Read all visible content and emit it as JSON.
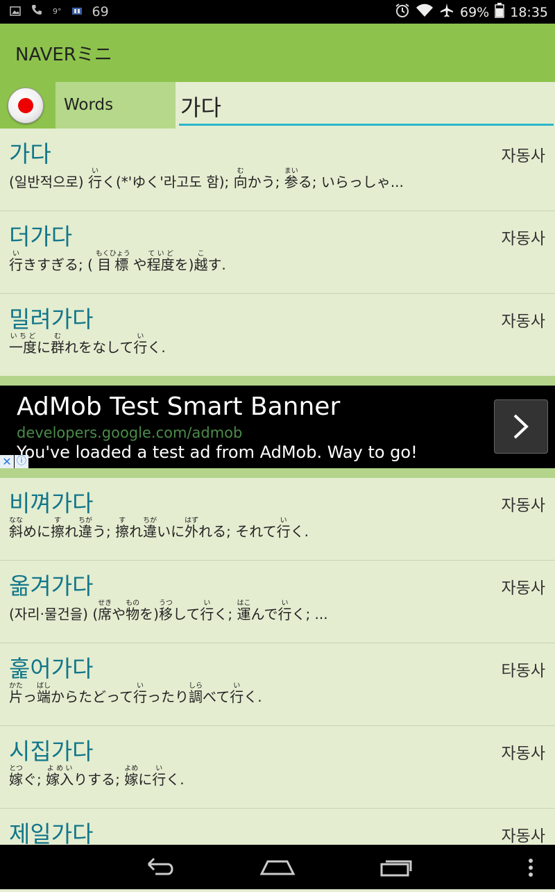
{
  "status_bar": {
    "left_icons": [
      "image-icon",
      "phone-icon",
      "notification-icon",
      "sim-icon"
    ],
    "notification_count": "69",
    "battery_percent": "69%",
    "time": "18:35",
    "right_icons": [
      "alarm-icon",
      "wifi-icon",
      "airplane-icon",
      "battery-icon"
    ]
  },
  "app_bar": {
    "title": "NAVERミニ"
  },
  "search": {
    "mode_label": "Words",
    "query": "가다"
  },
  "entries_top": [
    {
      "word": "가다",
      "pos": "자동사"
    },
    {
      "word": "더가다",
      "pos": "자동사"
    },
    {
      "word": "밀려가다",
      "pos": "자동사"
    }
  ],
  "ad": {
    "title": "AdMob Test Smart Banner",
    "url": "developers.google.com/admob",
    "text": "You've loaded a test ad from AdMob. Way to go!"
  },
  "entries_bottom": [
    {
      "word": "비껴가다",
      "pos": "자동사"
    },
    {
      "word": "옮겨가다",
      "pos": "자동사"
    },
    {
      "word": "훑어가다",
      "pos": "타동사"
    },
    {
      "word": "시집가다",
      "pos": "자동사"
    },
    {
      "word": "제일가다",
      "pos": "자동사"
    }
  ],
  "definitions": {
    "e0": [
      {
        "t": "(일반적으로) "
      },
      {
        "r": "行",
        "f": "い"
      },
      {
        "t": "く(*'ゆく'라고도 함); "
      },
      {
        "r": "向",
        "f": "む"
      },
      {
        "t": "かう; "
      },
      {
        "r": "参",
        "f": "まい"
      },
      {
        "t": "る; いらっしゃ..."
      }
    ],
    "e1": [
      {
        "r": "行",
        "f": "い"
      },
      {
        "t": "きすぎる; ( "
      },
      {
        "r": "目標",
        "f": "もくひょう"
      },
      {
        "t": " や"
      },
      {
        "r": "程度",
        "f": "ていど"
      },
      {
        "t": "を)"
      },
      {
        "r": "越",
        "f": "こ"
      },
      {
        "t": "す."
      }
    ],
    "e2": [
      {
        "r": "一度",
        "f": "いちど"
      },
      {
        "t": "に"
      },
      {
        "r": "群",
        "f": "む"
      },
      {
        "t": "れをなして"
      },
      {
        "r": "行",
        "f": "い"
      },
      {
        "t": "く."
      }
    ],
    "e3": [
      {
        "r": "斜",
        "f": "なな"
      },
      {
        "t": "めに"
      },
      {
        "r": "擦",
        "f": "す"
      },
      {
        "t": "れ"
      },
      {
        "r": "違",
        "f": "ちが"
      },
      {
        "t": "う; "
      },
      {
        "r": "擦",
        "f": "す"
      },
      {
        "t": "れ"
      },
      {
        "r": "違",
        "f": "ちが"
      },
      {
        "t": "いに"
      },
      {
        "r": "外",
        "f": "はず"
      },
      {
        "t": "れる; それて"
      },
      {
        "r": "行",
        "f": "い"
      },
      {
        "t": "く."
      }
    ],
    "e4": [
      {
        "t": "(자리·물건을) ("
      },
      {
        "r": "席",
        "f": "せき"
      },
      {
        "t": "や"
      },
      {
        "r": "物",
        "f": "もの"
      },
      {
        "t": "を)"
      },
      {
        "r": "移",
        "f": "うつ"
      },
      {
        "t": "して"
      },
      {
        "r": "行",
        "f": "い"
      },
      {
        "t": "く; "
      },
      {
        "r": "運",
        "f": "はこ"
      },
      {
        "t": "んで"
      },
      {
        "r": "行",
        "f": "い"
      },
      {
        "t": "く; ..."
      }
    ],
    "e5": [
      {
        "r": "片",
        "f": "かた"
      },
      {
        "t": "っ"
      },
      {
        "r": "端",
        "f": "ぱし"
      },
      {
        "t": "からたどって"
      },
      {
        "r": "行",
        "f": "い"
      },
      {
        "t": "ったり"
      },
      {
        "r": "調",
        "f": "しら"
      },
      {
        "t": "べて"
      },
      {
        "r": "行",
        "f": "い"
      },
      {
        "t": "く."
      }
    ],
    "e6": [
      {
        "r": "嫁",
        "f": "とつ"
      },
      {
        "t": "ぐ; "
      },
      {
        "r": "嫁入",
        "f": "よめい"
      },
      {
        "t": "りする; "
      },
      {
        "r": "嫁",
        "f": "よめ"
      },
      {
        "t": "に"
      },
      {
        "r": "行",
        "f": "い"
      },
      {
        "t": "く."
      }
    ]
  },
  "colors": {
    "app_bar": "#8dc34c",
    "background": "#e4edd0",
    "word_text": "#11768a",
    "input_underline": "#2ab6c9",
    "record_dot": "#ee0000"
  },
  "nav_bar": {
    "icons": [
      "back-icon",
      "home-icon",
      "recent-apps-icon",
      "overflow-menu-icon"
    ]
  }
}
